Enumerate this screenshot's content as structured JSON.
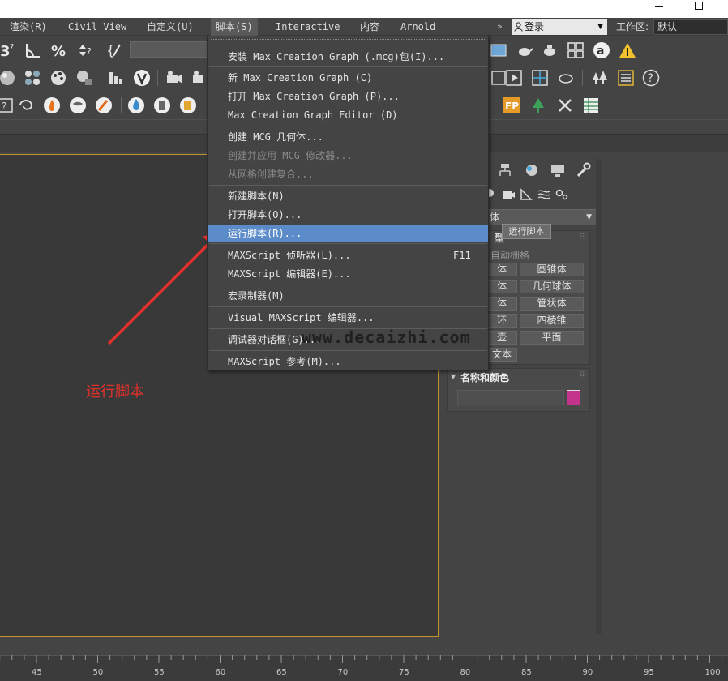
{
  "window": {
    "minimize": "",
    "maximize": ""
  },
  "menubar": {
    "items": [
      {
        "label": "渲染(R)"
      },
      {
        "label": "Civil View"
      },
      {
        "label": "自定义(U)"
      },
      {
        "label": "脚本(S)"
      },
      {
        "label": "Interactive"
      },
      {
        "label": "内容"
      },
      {
        "label": "Arnold"
      }
    ],
    "overflow": "»",
    "login": "登录",
    "workspace_label": "工作区:",
    "workspace_value": "默认"
  },
  "script_menu": {
    "items": [
      {
        "label": "安装 Max Creation Graph (.mcg)包(I)...",
        "enabled": true
      },
      {
        "label": "新 Max Creation Graph (C)",
        "enabled": true
      },
      {
        "label": "打开 Max Creation Graph (P)...",
        "enabled": true
      },
      {
        "label": "Max Creation Graph Editor (D)",
        "enabled": true
      },
      {
        "label": "创建 MCG 几何体...",
        "enabled": true
      },
      {
        "label": "创建并应用 MCG 修改器...",
        "enabled": false
      },
      {
        "label": "从网格创建复合...",
        "enabled": false
      },
      {
        "label": "新建脚本(N)",
        "enabled": true
      },
      {
        "label": "打开脚本(O)...",
        "enabled": true
      },
      {
        "label": "运行脚本(R)...",
        "enabled": true,
        "highlighted": true
      },
      {
        "label": "MAXScript 侦听器(L)...",
        "enabled": true,
        "shortcut": "F11"
      },
      {
        "label": "MAXScript 编辑器(E)...",
        "enabled": true
      },
      {
        "label": "宏录制器(M)",
        "enabled": true
      },
      {
        "label": "Visual MAXScript 编辑器...",
        "enabled": true
      },
      {
        "label": "调试器对话框(G)...",
        "enabled": true
      },
      {
        "label": "MAXScript 参考(M)...",
        "enabled": true
      }
    ]
  },
  "watermark": "www.decaizhi.com",
  "annotation": {
    "label": "运行脚本",
    "color": "#e2302a"
  },
  "command_panel": {
    "dropdown_value": "体",
    "tooltip": "运行脚本",
    "object_type_title": "型",
    "auto_grid": "自动栅格",
    "buttons": [
      {
        "label": "体"
      },
      {
        "label": "圆锥体"
      },
      {
        "label": "体"
      },
      {
        "label": "几何球体"
      },
      {
        "label": "体"
      },
      {
        "label": "管状体"
      },
      {
        "label": "环"
      },
      {
        "label": "四棱锥"
      },
      {
        "label": "壶"
      },
      {
        "label": "平面"
      },
      {
        "label": "文本"
      }
    ],
    "name_color_title": "名称和颜色",
    "object_color": "#c4338b"
  },
  "timeline": {
    "ticks": [
      "45",
      "50",
      "55",
      "60",
      "65",
      "70",
      "75",
      "80",
      "85",
      "90",
      "95",
      "100"
    ]
  },
  "colors": {
    "highlight": "#5b8bc8",
    "viewport_border": "#c2942c"
  }
}
